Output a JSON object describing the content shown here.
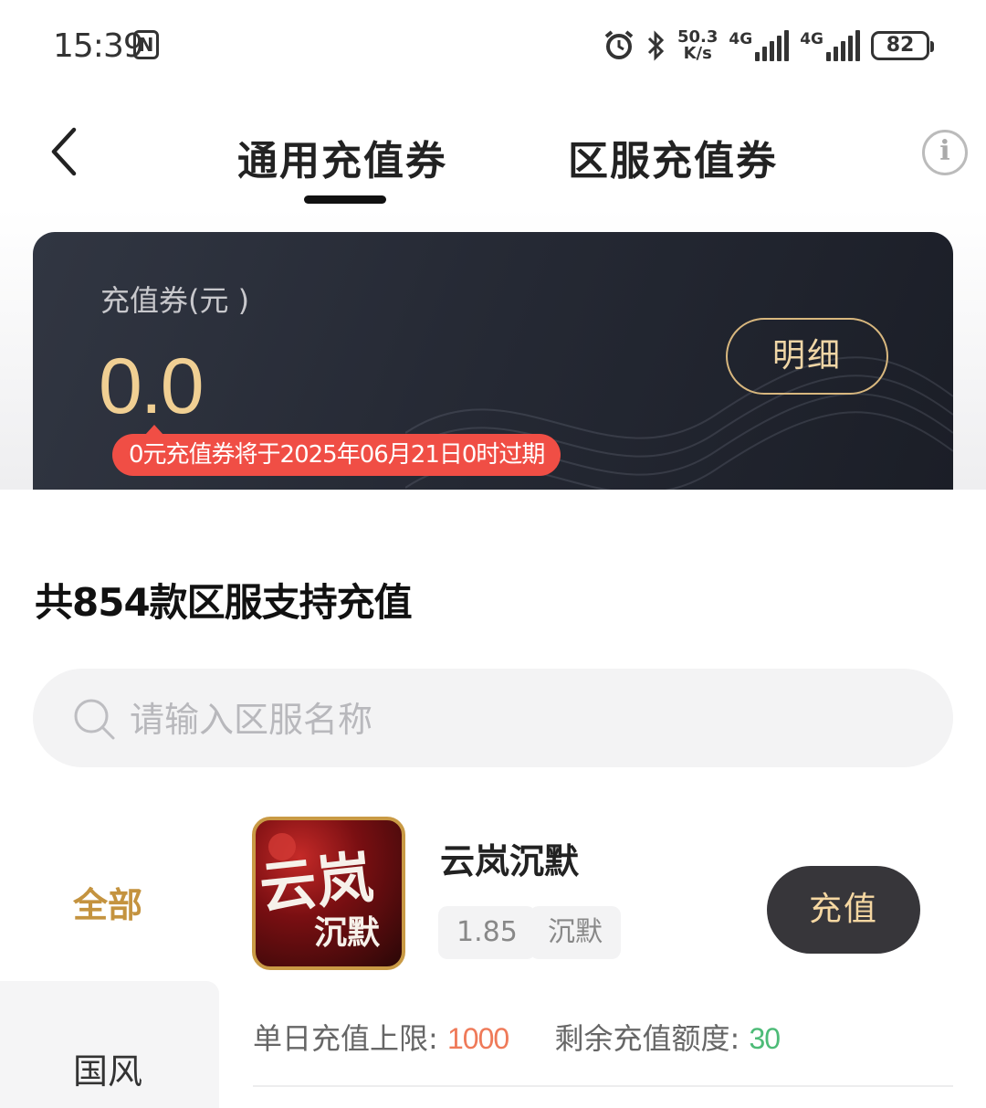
{
  "status_bar": {
    "time": "15:39",
    "nfc_label": "N",
    "net_speed_value": "50.3",
    "net_speed_unit": "K/s",
    "sim1_label": "4G",
    "sim2_label": "4G",
    "battery_level": "82"
  },
  "header": {
    "tabs": [
      {
        "label": "通用充值券",
        "active": true
      },
      {
        "label": "区服充值券",
        "active": false
      }
    ],
    "info_icon": "i"
  },
  "voucher_card": {
    "label": "充值券(元 )",
    "amount": "0.0",
    "detail_button": "明细",
    "expire_notice": "0元充值券将于2025年06月21日0时过期"
  },
  "section_title": "共854款区服支持充值",
  "search": {
    "placeholder": "请输入区服名称",
    "value": ""
  },
  "categories": [
    {
      "label": "全部",
      "active": true
    },
    {
      "label": "国风",
      "active": false
    }
  ],
  "games": [
    {
      "name": "云岚沉默",
      "icon_text_top": "云岚",
      "icon_text_bottom": "沉默",
      "tags": [
        "1.85",
        "沉默"
      ],
      "recharge_button": "充值",
      "daily_limit_label": "单日充值上限:",
      "daily_limit_value": "1000",
      "remaining_label": "剩余充值额度:",
      "remaining_value": "30"
    }
  ],
  "colors": {
    "accent_gold": "#c4933f",
    "amount_gold": "#f0cf93",
    "alert_red": "#f04e45",
    "limit_orange": "#ef7a59",
    "remain_green": "#4dbb77",
    "card_dark": "#262a35"
  }
}
